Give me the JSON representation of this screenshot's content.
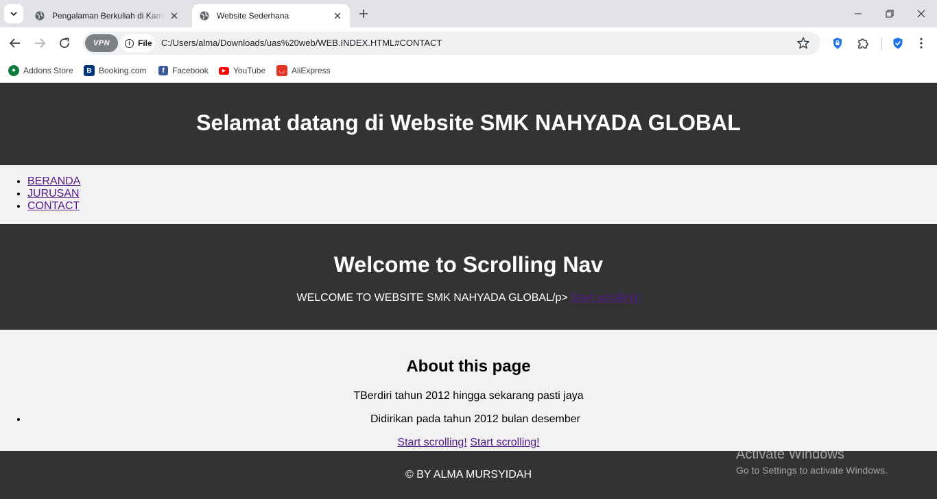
{
  "browser": {
    "tabs": [
      {
        "title": "Pengalaman Berkuliah di Kampus",
        "active": false
      },
      {
        "title": "Website Sederhana",
        "active": true
      }
    ],
    "omnibox": {
      "vpn_label": "VPN",
      "file_chip_label": "File",
      "url": "C:/Users/alma/Downloads/uas%20web/WEB.INDEX.HTML#CONTACT"
    },
    "bookmarks": [
      {
        "label": "Addons Store",
        "icon": "addons-store-icon",
        "color": "#0f7a3a"
      },
      {
        "label": "Booking.com",
        "icon": "booking-icon",
        "color": "#003580"
      },
      {
        "label": "Facebook",
        "icon": "facebook-icon",
        "color": "#3b5998"
      },
      {
        "label": "YouTube",
        "icon": "youtube-icon",
        "color": "#ff0000"
      },
      {
        "label": "AliExpress",
        "icon": "aliexpress-icon",
        "color": "#e43225"
      }
    ]
  },
  "site": {
    "header_title": "Selamat datang di Website SMK NAHYADA GLOBAL",
    "nav_items": [
      "BERANDA",
      "JURUSAN",
      "CONTACT"
    ],
    "hero": {
      "title": "Welcome to Scrolling Nav",
      "text": "WELCOME TO WEBSITE SMK NAHYADA GLOBAL/p>",
      "link": "Start scrolling!"
    },
    "about": {
      "title": "About this page",
      "paragraph": "TBerdiri tahun 2012 hingga sekarang pasti jaya",
      "list_item": "Didirikan pada tahun 2012 bulan desember",
      "link_1": "Start scrolling!",
      "link_2": "Start scrolling!"
    },
    "footer": "© BY ALMA MURSYIDAH"
  },
  "os_watermark": {
    "line1": "Activate Windows",
    "line2": "Go to Settings to activate Windows."
  },
  "colors": {
    "page_dark": "#333333",
    "page_light": "#f2f2f2",
    "link": "#551a8b",
    "tabstrip": "#e1e3e6",
    "omnibox": "#eff1f3"
  }
}
